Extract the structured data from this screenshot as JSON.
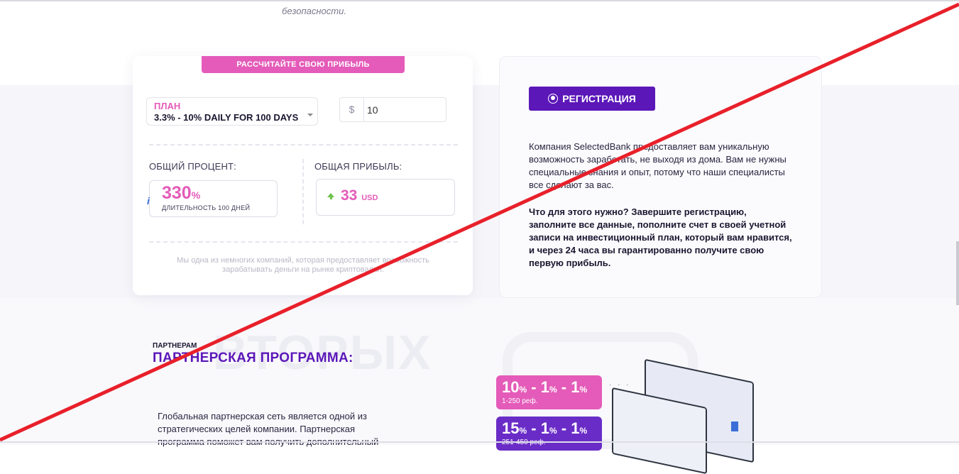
{
  "top": {
    "text": "безопасности."
  },
  "calculator": {
    "button_label": "РАССЧИТАЙТЕ СВОЮ ПРИБЫЛЬ",
    "plan_label": "ПЛАН",
    "plan_value": "3.3% - 10% DAILY FOR 100 DAYS",
    "currency_symbol": "$",
    "amount_value": "10",
    "percent_label": "ОБЩИЙ ПРОЦЕНТ:",
    "profit_label": "ОБЩАЯ ПРИБЫЛЬ:",
    "percent_value": "330",
    "percent_sign": "%",
    "duration": "ДЛИТЕЛЬНОСТЬ 100 ДНЕЙ",
    "profit_value": "33",
    "profit_currency": "USD",
    "note": "Мы одна из немногих компаний, которая предоставляет возможность зарабатывать деньги на рынке криптовалют."
  },
  "registration": {
    "button_label": "РЕГИСТРАЦИЯ",
    "text1": "Компания SelectedBank предоставляет вам уникальную возможность заработать, не выходя из дома. Вам не нужны специальные знания и опыт, потому что наши специалисты все сделают за вас.",
    "text2": "Что для этого нужно? Завершите регистрацию, заполните все данные, пополните счет в своей учетной записи на инвестиционный план, который вам нравится, и через 24 часа вы гарантированно получите свою первую прибыль."
  },
  "partner": {
    "watermark": "ВТОРЫХ",
    "small_label": "ПАРТНЕРАМ",
    "title": "ПАРТНЕРСКАЯ ПРОГРАММА:",
    "text": "Глобальная партнерская сеть является одной из стратегических целей компании. Партнерская программа поможет вам получить дополнительный"
  },
  "tiers": [
    {
      "l1": "10",
      "l2": "1",
      "l3": "1",
      "pct": "%",
      "sep": " - ",
      "sub": "1-250 реф."
    },
    {
      "l1": "15",
      "l2": "1",
      "l3": "1",
      "pct": "%",
      "sep": " - ",
      "sub": "251-450 реф."
    }
  ],
  "colors": {
    "accent_pink": "#e45bb9",
    "accent_purple": "#5b17b8",
    "strike_red": "#e8202a"
  }
}
